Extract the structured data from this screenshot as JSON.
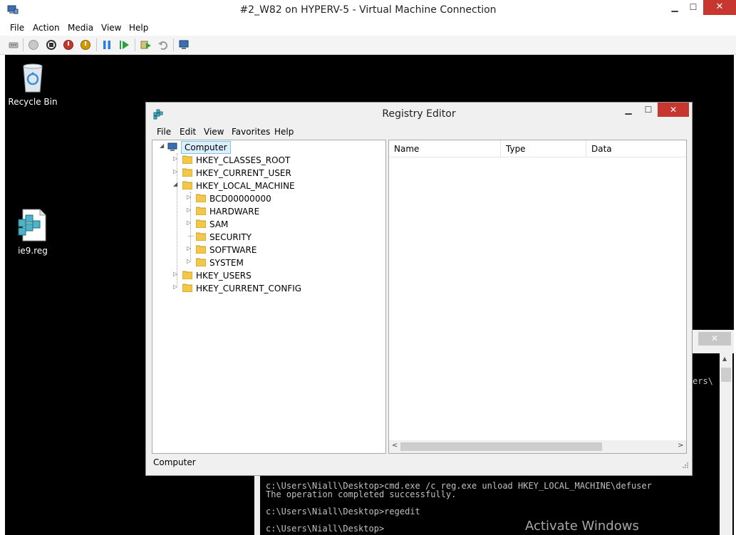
{
  "host": {
    "title": "#2_W82 on HYPERV-5 - Virtual Machine Connection",
    "controls": {
      "minimize": "▁",
      "maximize": "☐",
      "close": "✕"
    },
    "menu": [
      "File",
      "Action",
      "Media",
      "View",
      "Help"
    ],
    "toolbar_icons": [
      "ctrl-alt-del-icon",
      "start-icon",
      "turn-off-icon",
      "shutdown-icon",
      "save-icon",
      "pause-icon",
      "resume-icon",
      "checkpoint-icon",
      "revert-icon",
      "enhanced-session-icon"
    ],
    "colors": {
      "shutdown": "#c0392b",
      "save": "#d49a00",
      "pause": "#2b7de0",
      "resume": "#2ea043"
    }
  },
  "desktop": {
    "icons": [
      {
        "label": "Recycle Bin",
        "icon": "recycle-bin-icon"
      },
      {
        "label": "ie9.reg",
        "icon": "reg-file-icon"
      }
    ]
  },
  "regedit": {
    "title": "Registry Editor",
    "controls": {
      "minimize": "▁",
      "maximize": "☐",
      "close": "✕"
    },
    "menu": [
      "File",
      "Edit",
      "View",
      "Favorites",
      "Help"
    ],
    "tree": {
      "root": "Computer",
      "hives": [
        {
          "label": "HKEY_CLASSES_ROOT",
          "expander": "▷"
        },
        {
          "label": "HKEY_CURRENT_USER",
          "expander": "▷"
        },
        {
          "label": "HKEY_LOCAL_MACHINE",
          "expander": "◢"
        },
        {
          "label": "HKEY_USERS",
          "expander": "▷"
        },
        {
          "label": "HKEY_CURRENT_CONFIG",
          "expander": "▷"
        }
      ],
      "hklm_children": [
        {
          "label": "BCD00000000",
          "expander": "▷"
        },
        {
          "label": "HARDWARE",
          "expander": "▷"
        },
        {
          "label": "SAM",
          "expander": "▷"
        },
        {
          "label": "SECURITY",
          "expander": ""
        },
        {
          "label": "SOFTWARE",
          "expander": "▷"
        },
        {
          "label": "SYSTEM",
          "expander": "▷"
        }
      ],
      "root_expander": "◢"
    },
    "columns": [
      "Name",
      "Type",
      "Data"
    ],
    "scroll": {
      "left": "<",
      "right": ">"
    },
    "status": "Computer"
  },
  "console": {
    "close": "✕",
    "partial_text": "ers\\",
    "lines": [
      "c:\\Users\\Niall\\Desktop>cmd.exe /c reg.exe unload HKEY_LOCAL_MACHINE\\defuser",
      "The operation completed successfully.",
      "",
      "c:\\Users\\Niall\\Desktop>regedit",
      "",
      "c:\\Users\\Niall\\Desktop>"
    ]
  },
  "watermark": "Activate Windows"
}
